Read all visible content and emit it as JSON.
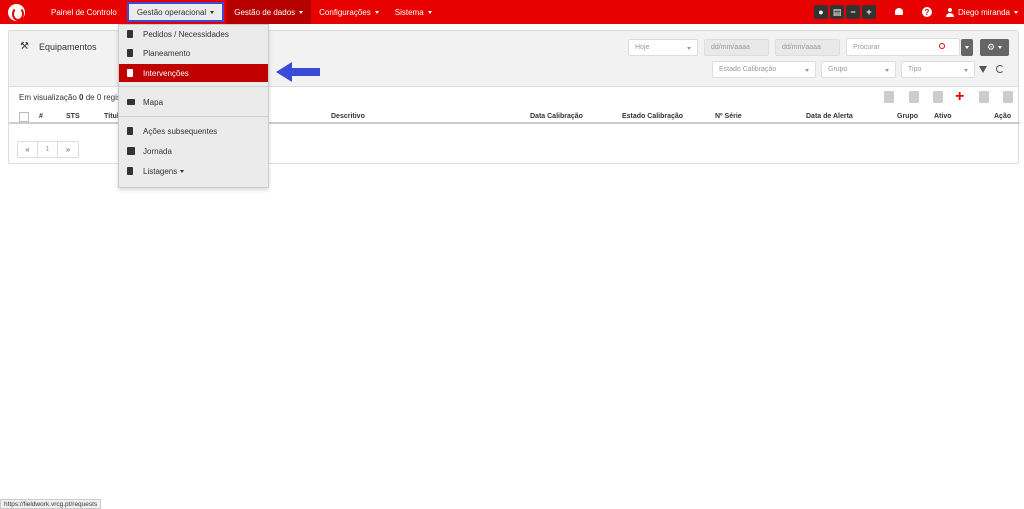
{
  "nav": {
    "items": [
      {
        "label": "Painel de Controlo"
      },
      {
        "label": "Gestão operacional"
      },
      {
        "label": "Gestão de dados"
      },
      {
        "label": "Configurações"
      },
      {
        "label": "Sistema"
      }
    ],
    "user": "Diego miranda",
    "help": "?",
    "accent": "#e60000"
  },
  "dropdown": {
    "items": [
      {
        "label": "Pedidos / Necessidades",
        "icon": "document-icon"
      },
      {
        "label": "Planeamento",
        "icon": "calendar-icon"
      },
      {
        "label": "Intervenções",
        "icon": "document-icon",
        "selected": true
      },
      {
        "label": "Mapa",
        "icon": "map-icon"
      },
      {
        "label": "Ações subsequentes",
        "icon": "clipboard-icon"
      },
      {
        "label": "Jornada",
        "icon": "road-icon"
      },
      {
        "label": "Listagens",
        "icon": "trash-icon"
      }
    ]
  },
  "card": {
    "title": "Equipamentos",
    "date_filter": "Hoje",
    "date_from": "dd/mm/aaaa",
    "date_to": "dd/mm/aaaa",
    "search_placeholder": "Procurar",
    "filters": {
      "calibration_state": "Estado Calibração",
      "group": "Grupo",
      "type": "Tipo"
    },
    "viz_prefix": "Em visualização",
    "viz_count": "0",
    "viz_suffix": "de 0 regis",
    "columns": [
      "#",
      "STS",
      "Título",
      "Descritivo",
      "Data Calibração",
      "Estado Calibração",
      "Nº Série",
      "Data de Alerta",
      "Grupo",
      "Ativo",
      "Ação"
    ],
    "pager": {
      "prev": "«",
      "page": "1",
      "next": "»"
    }
  },
  "status_url": "https://fieldwork.vrcg.pt/requests"
}
